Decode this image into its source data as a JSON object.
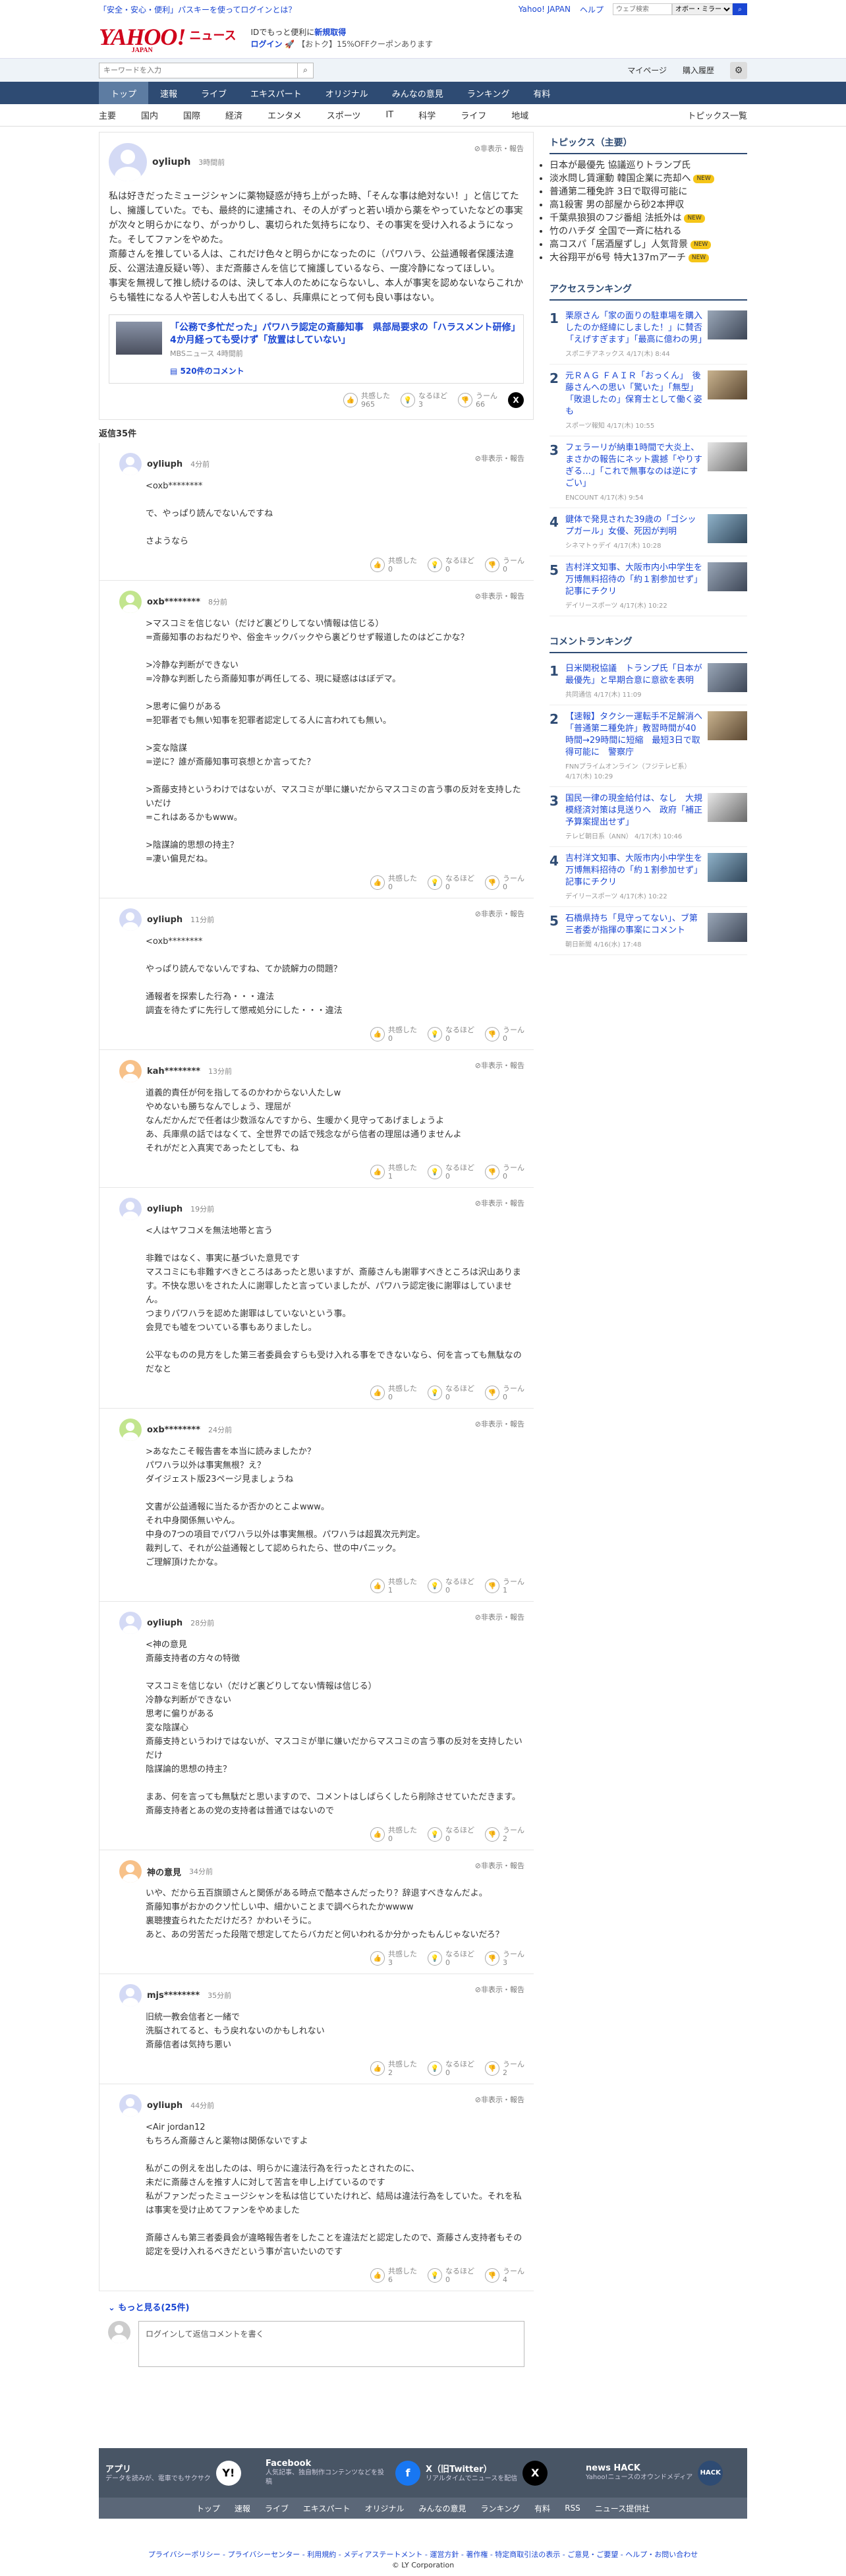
{
  "topbar": {
    "left_text": "「安全・安心・便利」パスキーを使ってログインとは？",
    "links": [
      "Yahoo! JAPAN",
      "ヘルプ"
    ],
    "search_placeholder": "ウェブ検索",
    "search_select": "オボー・ミラー"
  },
  "header": {
    "logo_text": "YAHOO!",
    "logo_sub": "JAPAN",
    "news_label": "ニュース",
    "promo_line1": "IDでもっと便利に",
    "promo_link": "新規取得",
    "promo_login": "ログイン",
    "promo_coupon": "【おトク】15%OFFクーポンあります"
  },
  "searchbar": {
    "placeholder": "キーワードを入力",
    "links": [
      "マイページ",
      "購入履歴"
    ]
  },
  "global_nav": [
    "トップ",
    "速報",
    "ライブ",
    "エキスパート",
    "オリジナル",
    "みんなの意見",
    "ランキング",
    "有料"
  ],
  "global_nav_active": "トップ",
  "sub_nav": [
    "主要",
    "国内",
    "国際",
    "経済",
    "エンタメ",
    "スポーツ",
    "IT",
    "科学",
    "ライフ",
    "地域"
  ],
  "sub_nav_right": "トピックス一覧",
  "main_comment": {
    "user": "oyliuph",
    "time": "3時間前",
    "meta": "非表示・報告",
    "body": "私は好きだったミュージシャンに薬物疑惑が持ち上がった時、「そんな事は絶対ない！」と信じてたし、擁護していた。でも、最終的に逮捕され、その人がずっと若い頃から薬をやっていたなどの事実が次々と明らかになり、がっかりし、裏切られた気持ちになり、その事実を受け入れるようになった。そしてファンをやめた。\n斎藤さんを推している人は、これだけ色々と明らかになったのに（パワハラ、公益通報者保護法違反、公選法違反疑い等）、まだ斎藤さんを信じて擁護しているなら、一度冷静になってほしい。\n事実を無視して推し続けるのは、決して本人のためにならないし、本人が事実を認めないならこれからも犠牲になる人や苦しむ人も出てくるし、兵庫県にとって何も良い事はない。",
    "article_title": "「公務で多忙だった」パワハラ認定の斎藤知事　県部局要求の「ハラスメント研修」4か月経っても受けず「放置はしていない」",
    "article_source": "MBSニュース 4時間前",
    "article_comments": "520件のコメント",
    "reactions": [
      {
        "label": "共感した",
        "count": "965"
      },
      {
        "label": "なるほど",
        "count": "3"
      },
      {
        "label": "うーん",
        "count": "66"
      }
    ]
  },
  "reply_count": "返信35件",
  "replies": [
    {
      "user": "oyliuph",
      "time": "4分前",
      "avatar": "blue",
      "body": "<oxb********\n\nで、やっぱり読んでないんですね\n\nさようなら",
      "r": [
        "0",
        "0",
        "0"
      ]
    },
    {
      "user": "oxb********",
      "time": "8分前",
      "avatar": "green",
      "body": ">マスコミを信じない（だけど裏どりしてない情報は信じる）\n=斎藤知事のおねだりや、俗金キックバックやら裏どりせず報道したのはどこかな？\n\n>冷静な判断ができない\n=冷静な判断したら斎藤知事が再任してる、現に疑惑ははぼデマ。\n\n>思考に偏りがある\n=犯罪者でも無い知事を犯罪者認定してる人に言われても無い。\n\n>変な陰謀\n=逆に？誰が斎藤知事可哀想とか言ってた？\n\n>斎藤支持というわけではないが、マスコミが単に嫌いだからマスコミの言う事の反対を支持したいだけ\n=これはあるかもwww。\n\n>陰謀論的思想の持主？\n=凄い偏見だね。",
      "r": [
        "0",
        "0",
        "0"
      ]
    },
    {
      "user": "oyliuph",
      "time": "11分前",
      "avatar": "blue",
      "body": "<oxb********\n\nやっぱり読んでないんですね、てか読解力の問題？\n\n通報者を探索した行為・・・違法\n調査を待たずに先行して懲戒処分にした・・・違法",
      "r": [
        "0",
        "0",
        "0"
      ]
    },
    {
      "user": "kah********",
      "time": "13分前",
      "avatar": "orange",
      "body": "道義的責任が何を指してるのかわからない人たしw\nやめないも勝ちなんでしょう、理屈が\nなんだかんだで任者は少数派なんですから、生暖かく見守ってあげましょうよ\nあ、兵庫県の話ではなくて、全世界での話で残念ながら信者の理屈は通りませんよ\nそれがだと入真実であったとしても、ね",
      "r": [
        "1",
        "0",
        "0"
      ]
    },
    {
      "user": "oyliuph",
      "time": "19分前",
      "avatar": "blue",
      "body": "<人はヤフコメを無法地帯と言う\n\n非難ではなく、事実に基づいた意見です\nマスコミにも非難すべきところはあったと思いますが、斎藤さんも謝罪すべきところは沢山あります。不快な思いをされた人に謝罪したと言っていましたが、パワハラ認定後に謝罪はしていません。\nつまりパワハラを認めた謝罪はしていないという事。\n会見でも嘘をついている事もありましたし。\n\n公平なものの見方をした第三者委員会すらも受け入れる事をできないなら、何を言っても無駄なのだなと",
      "r": [
        "0",
        "0",
        "0"
      ]
    },
    {
      "user": "oxb********",
      "time": "24分前",
      "avatar": "green",
      "body": ">あなたこそ報告書を本当に読みましたか？\nパワハラ以外は事実無根？え？\nダイジェスト版23ページ見ましょうね\n\n文書が公益通報に当たるか否かのとこよwww。\nそれ中身関係無いやん。\n中身の7つの項目でパワハラ以外は事実無根。パワハラは超異次元判定。\n裁判して、それが公益通報として認められたら、世の中パニック。\nご理解頂けたかな。",
      "r": [
        "1",
        "0",
        "1"
      ]
    },
    {
      "user": "oyliuph",
      "time": "28分前",
      "avatar": "blue",
      "body": "<神の意見\n斎藤支持者の方々の特徴\n\nマスコミを信じない（だけど裏どりしてない情報は信じる）\n冷静な判断ができない\n思考に偏りがある\n変な陰謀心\n斎藤支持というわけではないが、マスコミが単に嫌いだからマスコミの言う事の反対を支持したいだけ\n陰謀論的思想の持主？\n\nまあ、何を言っても無駄だと思いますので、コメントはしばらくしたら削除させていただきます。\n斎藤支持者とあの党の支持者は普通ではないので",
      "r": [
        "0",
        "0",
        "2"
      ]
    },
    {
      "user": "神の意見",
      "time": "34分前",
      "avatar": "orange",
      "body": "いや、だから五百旗頭さんと関係がある時点で酷本さんだったり？辞退すべきなんだよ。\n斎藤知事がおかのクソ忙しい中、細かいことまで調べられたかwwww\n裏聴捜査られたただけだろ？かわいそうに。\nあと、あの労苦だった段階で想定してたらバカだと何いわれるか分かったもんじゃないだろ？",
      "r": [
        "3",
        "0",
        "3"
      ]
    },
    {
      "user": "mjs********",
      "time": "35分前",
      "avatar": "blue",
      "body": "旧統一教会信者と一緒で\n洗脳されてると、もう戻れないのかもしれない\n斎藤信者は気持ち悪い",
      "r": [
        "2",
        "0",
        "2"
      ]
    },
    {
      "user": "oyliuph",
      "time": "44分前",
      "avatar": "blue",
      "body": "<Air jordan12\nもちろん斎藤さんと薬物は関係ないですよ\n\n私がこの例えを出したのは、明らかに違法行為を行ったとされたのに、\n未だに斎藤さんを推す人に対して苦言を申し上げているのです\n私がファンだったミュージシャンを私は信じていたけれど、結局は違法行為をしていた。それを私は事実を受け止めてファンをやめました\n\n斎藤さんも第三者委員会が違略報告者をしたことを違法だと認定したので、斎藤さん支持者もその認定を受け入れるべきだという事が言いたいのです",
      "r": [
        "6",
        "0",
        "4"
      ]
    }
  ],
  "more_label": "もっと見る(25件)",
  "comment_form_placeholder": "ログインして返信コメントを書く",
  "sidebar": {
    "topics_title": "トピックス（主要）",
    "topics": [
      {
        "text": "日本が最優先 協議巡りトランプ氏",
        "badge": ""
      },
      {
        "text": "淡水問し賃運動 韓国企業に売却へ",
        "badge": "NEW"
      },
      {
        "text": "普通第二種免許 3日で取得可能に",
        "badge": ""
      },
      {
        "text": "高1殺害 男の部屋から砂2本押収",
        "badge": ""
      },
      {
        "text": "千葉県狼狽のフジ番組 法抵外は",
        "badge": "NEW"
      },
      {
        "text": "竹のハチダ 全国で一斉に枯れる",
        "badge": ""
      },
      {
        "text": "高コスパ「居酒屋ずし」人気背景",
        "badge": "NEW"
      },
      {
        "text": "大谷翔平が6号 特大137mアーチ",
        "badge": "NEW"
      }
    ],
    "access_title": "アクセスランキング",
    "access": [
      {
        "title": "栗原さん「家の面りの駐車場を購入したのか経緯にしました！」に賛否「えげすぎます」「最高に億わの男」",
        "src": "スポニチアネックス 4/17(木) 8:44"
      },
      {
        "title": "元ＲＡＧ ＦＡＩＲ「おっくん」　後藤さんへの思い「驚いた」「無型」「敗退したの」保育士として働く姿も",
        "src": "スポーツ報知 4/17(木) 10:55"
      },
      {
        "title": "フェラーリが納車1時間で大炎上、まさかの報告にネット震撼「やりすぎる…」「これで無事なのは逆にすごい」",
        "src": "ENCOUNT 4/17(木) 9:54"
      },
      {
        "title": "鍵体で発見された39歳の「ゴシップガール」女優、死因が判明",
        "src": "シネマトゥデイ 4/17(木) 10:28"
      },
      {
        "title": "吉村洋文知事、大阪市内小中学生を万博無料招待の「約１割参加せず」記事にチクリ",
        "src": "デイリースポーツ 4/17(木) 10:22"
      }
    ],
    "comment_title": "コメントランキング",
    "comments": [
      {
        "title": "日米関税協議　トランプ氏「日本が最優先」と早期合意に意欲を表明",
        "src": "共同通信 4/17(木) 11:09"
      },
      {
        "title": "【速報】タクシー運転手不足解消へ「普通第二種免許」教習時間が40時間→29時間に短縮　最短3日で取得可能に　警察庁",
        "src": "FNNプライムオンライン（フジテレビ系） 4/17(木) 10:29"
      },
      {
        "title": "国民一律の現金給付は、なし　大規模経済対策は見送りへ　政府「補正予算案提出せず」",
        "src": "テレビ朝日系（ANN） 4/17(木) 10:46"
      },
      {
        "title": "吉村洋文知事、大阪市内小中学生を万博無料招待の「約１割参加せず」記事にチクリ",
        "src": "デイリースポーツ 4/17(木) 10:22"
      },
      {
        "title": "石橋県持ち「見守ってない」、ブ第三者委が指揮の事案にコメント",
        "src": "朝日新聞 4/16(水) 17:48"
      }
    ]
  },
  "footer": {
    "apps": [
      {
        "title": "アプリ",
        "desc": "データを読みが、電車でもサクサク",
        "icon": "Y!"
      },
      {
        "title": "Facebook",
        "desc": "人気記事、独自制作コンテンツなどを投稿",
        "icon": "f"
      },
      {
        "title": "X（旧Twitter）",
        "desc": "リアルタイムでニュースを配信",
        "icon": "X"
      },
      {
        "title": "news HACK",
        "desc": "Yahoo!ニュースのオウンドメディア",
        "icon": "HACK"
      }
    ],
    "links": [
      "トップ",
      "速報",
      "ライブ",
      "エキスパート",
      "オリジナル",
      "みんなの意見",
      "ランキング",
      "有料",
      "RSS",
      "ニュース提供社"
    ],
    "legal": "プライバシーポリシー - プライバシーセンター - 利用規約 - メディアステートメント - 運営方針 - 著作権 - 特定商取引法の表示 - ご意見・ご要望 - ヘルプ・お問い合わせ",
    "copyright": "© LY Corporation"
  }
}
